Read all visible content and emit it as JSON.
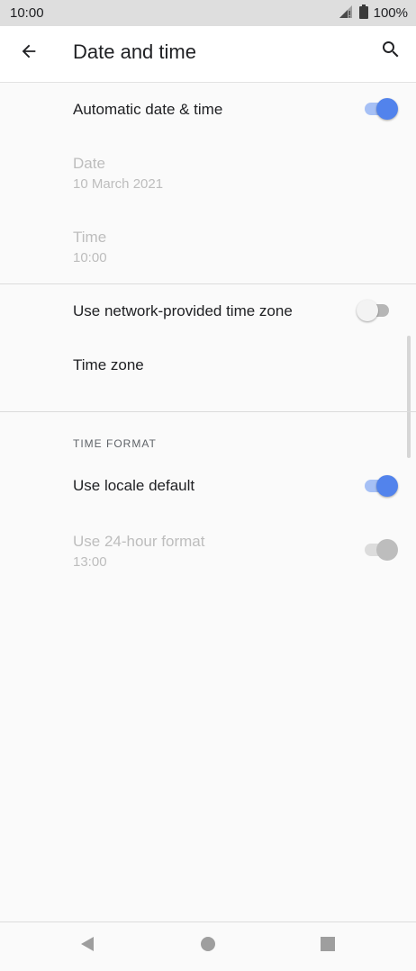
{
  "status_bar": {
    "time": "10:00",
    "battery_text": "100%",
    "signal_icon": "signal-icon",
    "battery_icon": "battery-icon"
  },
  "app_bar": {
    "title": "Date and time",
    "back_icon": "arrow-left-icon",
    "search_icon": "search-icon"
  },
  "settings": {
    "automatic_date_time": {
      "label": "Automatic date & time",
      "enabled": true
    },
    "date": {
      "label": "Date",
      "value": "10 March 2021"
    },
    "time": {
      "label": "Time",
      "value": "10:00"
    },
    "network_time_zone": {
      "label": "Use network-provided time zone",
      "enabled": false
    },
    "time_zone": {
      "label": "Time zone"
    },
    "time_format_header": "TIME FORMAT",
    "locale_default": {
      "label": "Use locale default",
      "enabled": true
    },
    "hour_24": {
      "label": "Use 24-hour format",
      "value": "13:00",
      "enabled": true
    }
  },
  "colors": {
    "accent": "#5283ec",
    "accent_track": "#a6c0f5"
  },
  "nav_bar": {
    "back_icon": "nav-back-icon",
    "home_icon": "nav-home-icon",
    "recents_icon": "nav-recents-icon"
  }
}
